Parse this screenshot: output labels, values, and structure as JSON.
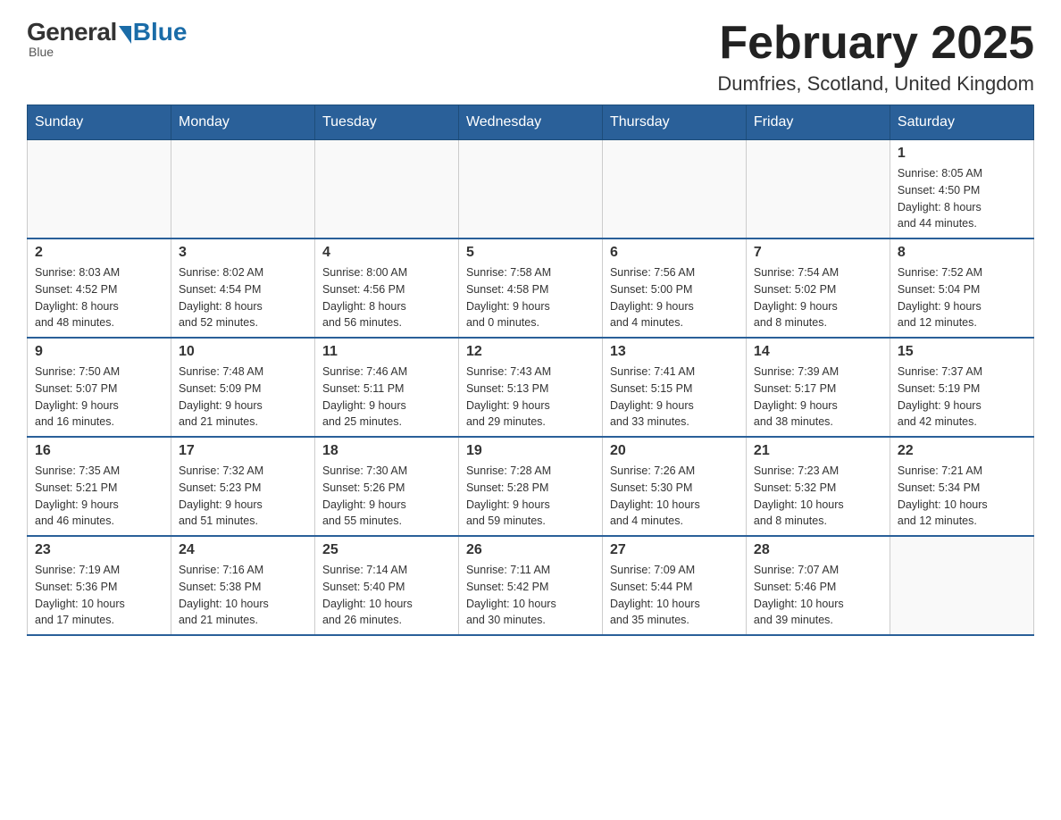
{
  "header": {
    "logo": {
      "general": "General",
      "blue": "Blue",
      "subtitle": "Blue"
    },
    "title": "February 2025",
    "subtitle": "Dumfries, Scotland, United Kingdom"
  },
  "weekdays": [
    "Sunday",
    "Monday",
    "Tuesday",
    "Wednesday",
    "Thursday",
    "Friday",
    "Saturday"
  ],
  "weeks": [
    [
      {
        "day": "",
        "info": ""
      },
      {
        "day": "",
        "info": ""
      },
      {
        "day": "",
        "info": ""
      },
      {
        "day": "",
        "info": ""
      },
      {
        "day": "",
        "info": ""
      },
      {
        "day": "",
        "info": ""
      },
      {
        "day": "1",
        "info": "Sunrise: 8:05 AM\nSunset: 4:50 PM\nDaylight: 8 hours\nand 44 minutes."
      }
    ],
    [
      {
        "day": "2",
        "info": "Sunrise: 8:03 AM\nSunset: 4:52 PM\nDaylight: 8 hours\nand 48 minutes."
      },
      {
        "day": "3",
        "info": "Sunrise: 8:02 AM\nSunset: 4:54 PM\nDaylight: 8 hours\nand 52 minutes."
      },
      {
        "day": "4",
        "info": "Sunrise: 8:00 AM\nSunset: 4:56 PM\nDaylight: 8 hours\nand 56 minutes."
      },
      {
        "day": "5",
        "info": "Sunrise: 7:58 AM\nSunset: 4:58 PM\nDaylight: 9 hours\nand 0 minutes."
      },
      {
        "day": "6",
        "info": "Sunrise: 7:56 AM\nSunset: 5:00 PM\nDaylight: 9 hours\nand 4 minutes."
      },
      {
        "day": "7",
        "info": "Sunrise: 7:54 AM\nSunset: 5:02 PM\nDaylight: 9 hours\nand 8 minutes."
      },
      {
        "day": "8",
        "info": "Sunrise: 7:52 AM\nSunset: 5:04 PM\nDaylight: 9 hours\nand 12 minutes."
      }
    ],
    [
      {
        "day": "9",
        "info": "Sunrise: 7:50 AM\nSunset: 5:07 PM\nDaylight: 9 hours\nand 16 minutes."
      },
      {
        "day": "10",
        "info": "Sunrise: 7:48 AM\nSunset: 5:09 PM\nDaylight: 9 hours\nand 21 minutes."
      },
      {
        "day": "11",
        "info": "Sunrise: 7:46 AM\nSunset: 5:11 PM\nDaylight: 9 hours\nand 25 minutes."
      },
      {
        "day": "12",
        "info": "Sunrise: 7:43 AM\nSunset: 5:13 PM\nDaylight: 9 hours\nand 29 minutes."
      },
      {
        "day": "13",
        "info": "Sunrise: 7:41 AM\nSunset: 5:15 PM\nDaylight: 9 hours\nand 33 minutes."
      },
      {
        "day": "14",
        "info": "Sunrise: 7:39 AM\nSunset: 5:17 PM\nDaylight: 9 hours\nand 38 minutes."
      },
      {
        "day": "15",
        "info": "Sunrise: 7:37 AM\nSunset: 5:19 PM\nDaylight: 9 hours\nand 42 minutes."
      }
    ],
    [
      {
        "day": "16",
        "info": "Sunrise: 7:35 AM\nSunset: 5:21 PM\nDaylight: 9 hours\nand 46 minutes."
      },
      {
        "day": "17",
        "info": "Sunrise: 7:32 AM\nSunset: 5:23 PM\nDaylight: 9 hours\nand 51 minutes."
      },
      {
        "day": "18",
        "info": "Sunrise: 7:30 AM\nSunset: 5:26 PM\nDaylight: 9 hours\nand 55 minutes."
      },
      {
        "day": "19",
        "info": "Sunrise: 7:28 AM\nSunset: 5:28 PM\nDaylight: 9 hours\nand 59 minutes."
      },
      {
        "day": "20",
        "info": "Sunrise: 7:26 AM\nSunset: 5:30 PM\nDaylight: 10 hours\nand 4 minutes."
      },
      {
        "day": "21",
        "info": "Sunrise: 7:23 AM\nSunset: 5:32 PM\nDaylight: 10 hours\nand 8 minutes."
      },
      {
        "day": "22",
        "info": "Sunrise: 7:21 AM\nSunset: 5:34 PM\nDaylight: 10 hours\nand 12 minutes."
      }
    ],
    [
      {
        "day": "23",
        "info": "Sunrise: 7:19 AM\nSunset: 5:36 PM\nDaylight: 10 hours\nand 17 minutes."
      },
      {
        "day": "24",
        "info": "Sunrise: 7:16 AM\nSunset: 5:38 PM\nDaylight: 10 hours\nand 21 minutes."
      },
      {
        "day": "25",
        "info": "Sunrise: 7:14 AM\nSunset: 5:40 PM\nDaylight: 10 hours\nand 26 minutes."
      },
      {
        "day": "26",
        "info": "Sunrise: 7:11 AM\nSunset: 5:42 PM\nDaylight: 10 hours\nand 30 minutes."
      },
      {
        "day": "27",
        "info": "Sunrise: 7:09 AM\nSunset: 5:44 PM\nDaylight: 10 hours\nand 35 minutes."
      },
      {
        "day": "28",
        "info": "Sunrise: 7:07 AM\nSunset: 5:46 PM\nDaylight: 10 hours\nand 39 minutes."
      },
      {
        "day": "",
        "info": ""
      }
    ]
  ]
}
